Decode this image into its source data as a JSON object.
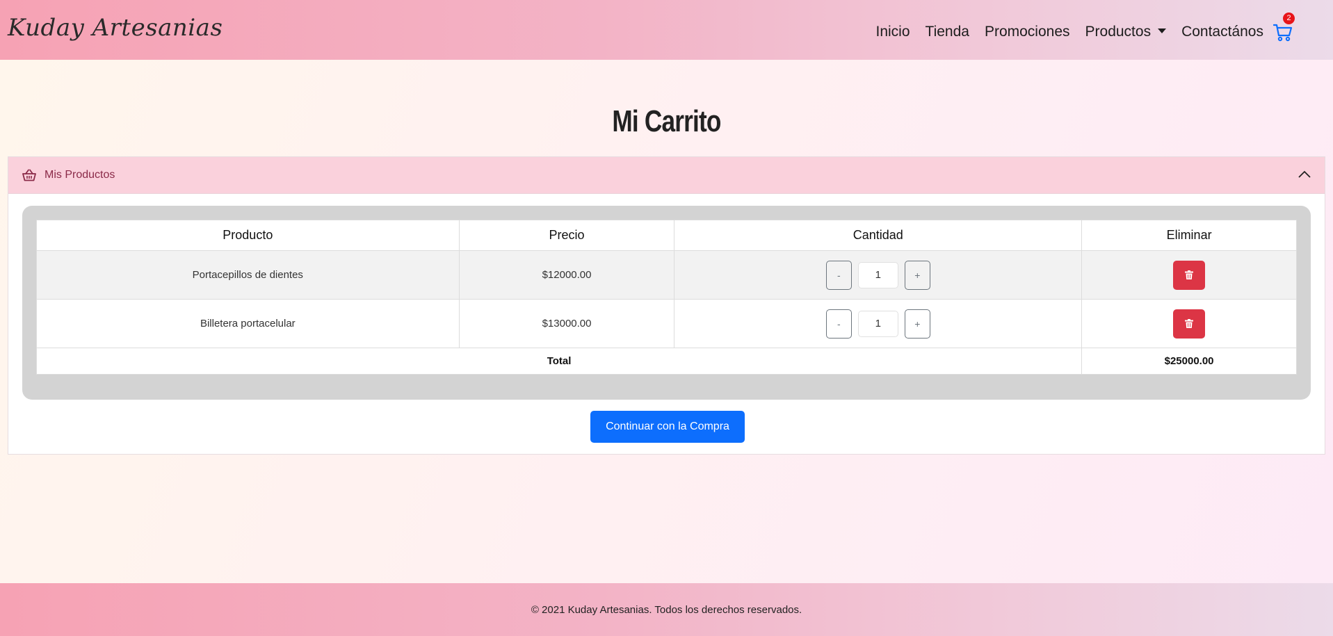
{
  "navbar": {
    "brand": "Kuday Artesanias",
    "links": [
      "Inicio",
      "Tienda",
      "Promociones",
      "Productos",
      "Contactános"
    ],
    "cart_count": "2",
    "cart_icon": "shopping-cart-icon"
  },
  "page": {
    "title": "Mi Carrito"
  },
  "accordion": {
    "title": "Mis Productos",
    "icon": "basket-icon",
    "toggle_icon": "chevron-up-icon"
  },
  "table": {
    "headers": [
      "Producto",
      "Precio",
      "Cantidad",
      "Eliminar"
    ],
    "rows": [
      {
        "product": "Portacepillos de dientes",
        "price": "$12000.00",
        "quantity": "1",
        "minus": "-",
        "plus": "+"
      },
      {
        "product": "Billetera portacelular",
        "price": "$13000.00",
        "quantity": "1",
        "minus": "-",
        "plus": "+"
      }
    ],
    "total_label": "Total",
    "total_value": "$25000.00",
    "delete_icon": "trash-icon"
  },
  "actions": {
    "continue_label": "Continuar con la Compra"
  },
  "footer": {
    "text": "© 2021 Kuday Artesanias. Todos los derechos reservados."
  },
  "colors": {
    "primary": "#0d6efd",
    "danger": "#dc3545",
    "badge": "#e8141a",
    "accordion_header": "#fad1dc"
  }
}
